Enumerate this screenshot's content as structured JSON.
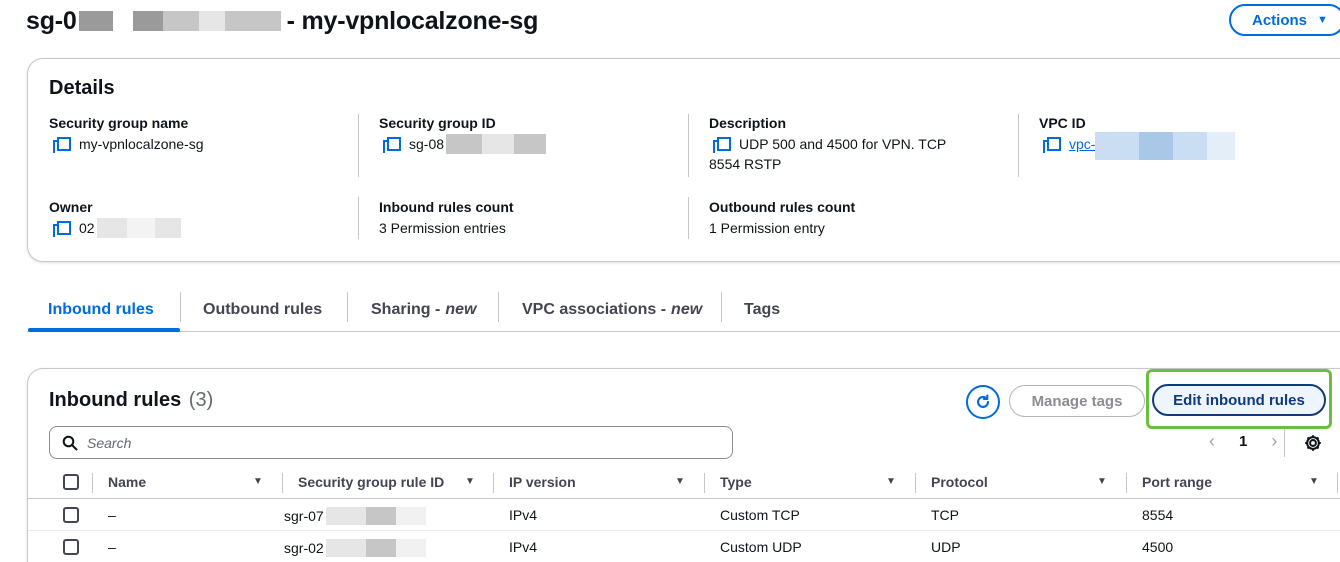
{
  "header": {
    "title_prefix": "sg-0",
    "title_suffix": "- my-vpnlocalzone-sg",
    "actions_label": "Actions"
  },
  "details": {
    "title": "Details",
    "fields": {
      "sg_name": {
        "label": "Security group name",
        "value": "my-vpnlocalzone-sg"
      },
      "sg_id": {
        "label": "Security group ID",
        "value": "sg-08"
      },
      "description": {
        "label": "Description",
        "value_line1": "UDP 500 and 4500 for VPN. TCP",
        "value_line2": "8554 RSTP"
      },
      "vpc_id": {
        "label": "VPC ID",
        "value": "vpc-"
      },
      "owner": {
        "label": "Owner",
        "value": "02"
      },
      "inbound_count": {
        "label": "Inbound rules count",
        "value": "3 Permission entries"
      },
      "outbound_count": {
        "label": "Outbound rules count",
        "value": "1 Permission entry"
      }
    }
  },
  "tabs": [
    {
      "label": "Inbound rules",
      "suffix": "",
      "active": true
    },
    {
      "label": "Outbound rules",
      "suffix": ""
    },
    {
      "label": "Sharing -",
      "suffix": "new"
    },
    {
      "label": "VPC associations -",
      "suffix": "new"
    },
    {
      "label": "Tags",
      "suffix": ""
    }
  ],
  "inbound": {
    "title": "Inbound rules",
    "count": "(3)",
    "manage_tags_label": "Manage tags",
    "edit_label": "Edit inbound rules",
    "search_placeholder": "Search",
    "page": "1",
    "columns": [
      "Name",
      "Security group rule ID",
      "IP version",
      "Type",
      "Protocol",
      "Port range"
    ],
    "rows": [
      {
        "name": "–",
        "rule_id": "sgr-07",
        "ip_version": "IPv4",
        "type": "Custom TCP",
        "protocol": "TCP",
        "port_range": "8554"
      },
      {
        "name": "–",
        "rule_id": "sgr-02",
        "ip_version": "IPv4",
        "type": "Custom UDP",
        "protocol": "UDP",
        "port_range": "4500"
      }
    ]
  },
  "colors": {
    "accent": "#006ce0",
    "highlight": "#6cbf3d",
    "dark_button": "#0f3a7c"
  },
  "icons": [
    "copy-icon",
    "refresh-icon",
    "search-icon",
    "chevron-left-icon",
    "chevron-right-icon",
    "gear-icon",
    "caret-down-icon",
    "sort-icon"
  ]
}
